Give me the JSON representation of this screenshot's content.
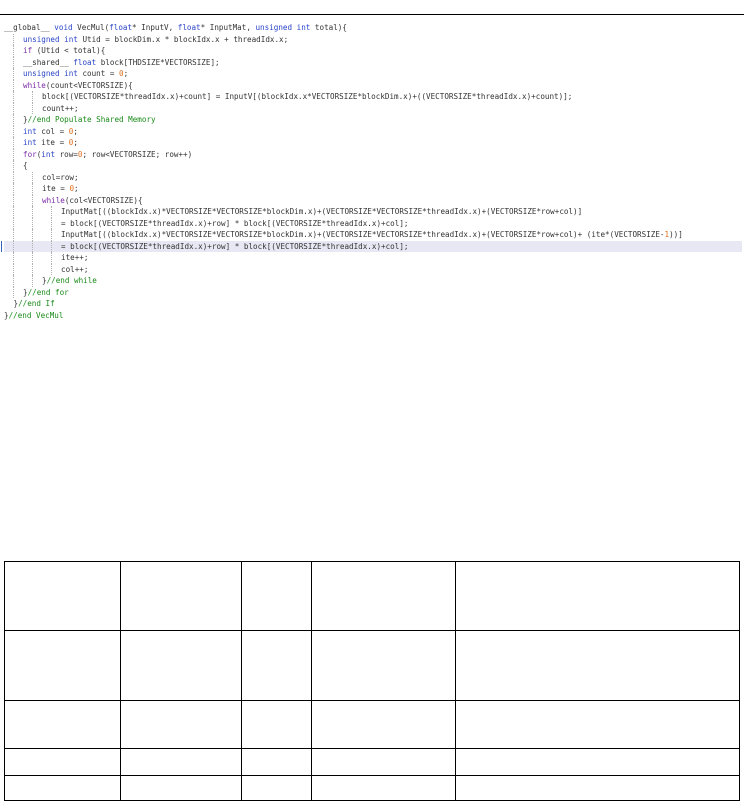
{
  "code_lines": [
    {
      "indent": 0,
      "tokens": [
        {
          "t": "__global__ ",
          "c": "def"
        },
        {
          "t": "void ",
          "c": "type"
        },
        {
          "t": "VecMul(",
          "c": "def"
        },
        {
          "t": "float",
          "c": "type"
        },
        {
          "t": "* InputV, ",
          "c": "def"
        },
        {
          "t": "float",
          "c": "type"
        },
        {
          "t": "* InputMat, ",
          "c": "def"
        },
        {
          "t": "unsigned int",
          "c": "type"
        },
        {
          "t": " total){",
          "c": "def"
        }
      ]
    },
    {
      "indent": 1,
      "tokens": [
        {
          "t": "unsigned int",
          "c": "type"
        },
        {
          "t": " Utid = blockDim.x * blockIdx.x + threadIdx.x;",
          "c": "def"
        }
      ]
    },
    {
      "indent": 1,
      "tokens": [
        {
          "t": "if ",
          "c": "kw"
        },
        {
          "t": "(Utid < total){",
          "c": "def"
        }
      ]
    },
    {
      "indent": 1,
      "tokens": [
        {
          "t": "__shared__ ",
          "c": "def"
        },
        {
          "t": "float",
          "c": "type"
        },
        {
          "t": " block[THDSIZE*VECTORSIZE];",
          "c": "def"
        }
      ]
    },
    {
      "indent": 1,
      "tokens": [
        {
          "t": "unsigned int",
          "c": "type"
        },
        {
          "t": " count = ",
          "c": "def"
        },
        {
          "t": "0",
          "c": "num"
        },
        {
          "t": ";",
          "c": "def"
        }
      ]
    },
    {
      "indent": 1,
      "tokens": [
        {
          "t": "while",
          "c": "kw"
        },
        {
          "t": "(count<VECTORSIZE){",
          "c": "def"
        }
      ]
    },
    {
      "indent": 2,
      "tokens": [
        {
          "t": "block[(VECTORSIZE*threadIdx.x)+count] = InputV[(blockIdx.x*VECTORSIZE*blockDim.x)+((VECTORSIZE*threadIdx.x)+count)];",
          "c": "def"
        }
      ]
    },
    {
      "indent": 2,
      "tokens": [
        {
          "t": "count++;",
          "c": "def"
        }
      ]
    },
    {
      "indent": 1,
      "tokens": [
        {
          "t": "}",
          "c": "def"
        },
        {
          "t": "//end Populate Shared Memory",
          "c": "cmt"
        }
      ]
    },
    {
      "indent": 1,
      "tokens": [
        {
          "t": "int",
          "c": "type"
        },
        {
          "t": " col = ",
          "c": "def"
        },
        {
          "t": "0",
          "c": "num"
        },
        {
          "t": ";",
          "c": "def"
        }
      ]
    },
    {
      "indent": 1,
      "tokens": [
        {
          "t": "int",
          "c": "type"
        },
        {
          "t": " ite = ",
          "c": "def"
        },
        {
          "t": "0",
          "c": "num"
        },
        {
          "t": ";",
          "c": "def"
        }
      ]
    },
    {
      "indent": 1,
      "tokens": [
        {
          "t": "for",
          "c": "kw"
        },
        {
          "t": "(",
          "c": "def"
        },
        {
          "t": "int",
          "c": "type"
        },
        {
          "t": " row=",
          "c": "def"
        },
        {
          "t": "0",
          "c": "num"
        },
        {
          "t": "; row<VECTORSIZE; row++)",
          "c": "def"
        }
      ]
    },
    {
      "indent": 1,
      "tokens": [
        {
          "t": "{",
          "c": "def"
        }
      ]
    },
    {
      "indent": 2,
      "tokens": [
        {
          "t": "col=row;",
          "c": "def"
        }
      ]
    },
    {
      "indent": 2,
      "tokens": [
        {
          "t": "ite = ",
          "c": "def"
        },
        {
          "t": "0",
          "c": "num"
        },
        {
          "t": ";",
          "c": "def"
        }
      ]
    },
    {
      "indent": 2,
      "tokens": [
        {
          "t": "while",
          "c": "kw"
        },
        {
          "t": "(col<VECTORSIZE){",
          "c": "def"
        }
      ]
    },
    {
      "indent": 3,
      "tokens": [
        {
          "t": "InputMat[((blockIdx.x)*VECTORSIZE*VECTORSIZE*blockDim.x)+(VECTORSIZE*VECTORSIZE*threadIdx.x)+(VECTORSIZE*row+col)]",
          "c": "def"
        }
      ]
    },
    {
      "indent": 3,
      "tokens": [
        {
          "t": "= block[(VECTORSIZE*threadIdx.x)+row] * block[(VECTORSIZE*threadIdx.x)+col];",
          "c": "def"
        }
      ]
    },
    {
      "indent": 3,
      "tokens": [
        {
          "t": "InputMat[((blockIdx.x)*VECTORSIZE*VECTORSIZE*blockDim.x)+(VECTORSIZE*VECTORSIZE*threadIdx.x)+(VECTORSIZE*row+col)+ (ite*(VECTORSIZE-",
          "c": "def"
        },
        {
          "t": "1",
          "c": "num"
        },
        {
          "t": "))]",
          "c": "def"
        }
      ]
    },
    {
      "indent": 3,
      "highlight": true,
      "tokens": [
        {
          "t": "= block[(VECTORSIZE*threadIdx.x)+row] * block[(VECTORSIZE*threadIdx.x)+col];",
          "c": "def"
        }
      ]
    },
    {
      "indent": 3,
      "tokens": [
        {
          "t": "ite++;",
          "c": "def"
        }
      ]
    },
    {
      "indent": 3,
      "tokens": [
        {
          "t": "col++;",
          "c": "def"
        }
      ]
    },
    {
      "indent": 2,
      "tokens": [
        {
          "t": "}",
          "c": "def"
        },
        {
          "t": "//end while",
          "c": "cmt"
        }
      ]
    },
    {
      "indent": 1,
      "tokens": [
        {
          "t": "}",
          "c": "def"
        },
        {
          "t": "//end for",
          "c": "cmt"
        }
      ]
    },
    {
      "indent": 0.5,
      "tokens": [
        {
          "t": "}",
          "c": "def"
        },
        {
          "t": "//end If",
          "c": "cmt"
        }
      ]
    },
    {
      "indent": 0,
      "tokens": [
        {
          "t": "}",
          "c": "def"
        },
        {
          "t": "//end VecMul",
          "c": "cmt"
        }
      ]
    }
  ],
  "empty_table": {
    "rows": 5,
    "cols": 5
  }
}
